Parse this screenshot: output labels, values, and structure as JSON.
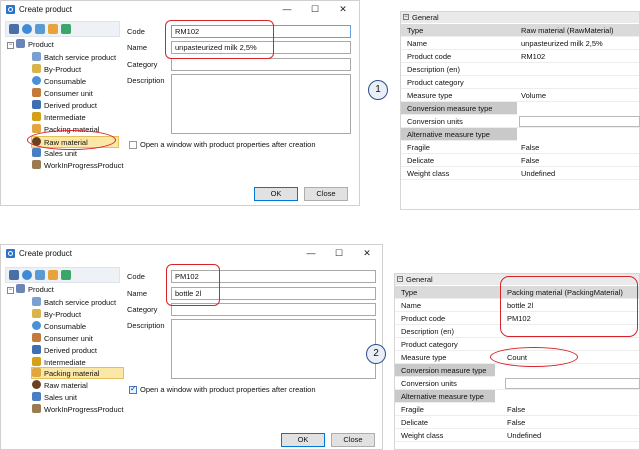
{
  "scene1": {
    "dialog": {
      "title": "Create product",
      "controls": [
        "—",
        "☐",
        "✕"
      ],
      "tree": [
        {
          "label": "Product"
        },
        {
          "label": "Batch service product"
        },
        {
          "label": "By-Product"
        },
        {
          "label": "Consumable"
        },
        {
          "label": "Consumer unit"
        },
        {
          "label": "Derived product"
        },
        {
          "label": "Intermediate"
        },
        {
          "label": "Packing material"
        },
        {
          "label": "Raw material"
        },
        {
          "label": "Sales unit"
        },
        {
          "label": "WorkInProgressProduct"
        }
      ],
      "selected_item": "Raw material",
      "code_label": "Code",
      "code_value": "RM102",
      "name_label": "Name",
      "name_value": "unpasteurized milk 2,5%",
      "category_label": "Category",
      "category_value": "",
      "description_label": "Description",
      "checkbox_label": "Open a window with product properties after creation",
      "checkbox_checked": false,
      "ok_label": "OK",
      "close_label": "Close"
    },
    "step_number": "1",
    "properties": {
      "section": "General",
      "rows": [
        {
          "name": "Type",
          "value": "Raw material (RawMaterial)"
        },
        {
          "name": "Name",
          "value": "unpasteurized milk 2,5%"
        },
        {
          "name": "Product code",
          "value": "RM102"
        },
        {
          "name": "Description (en)",
          "value": ""
        },
        {
          "name": "Product category",
          "value": ""
        },
        {
          "name": "Measure type",
          "value": "Volume"
        },
        {
          "name": "Conversion measure type",
          "value": ""
        },
        {
          "name": "Conversion units",
          "value": ""
        },
        {
          "name": "Alternative measure type",
          "value": ""
        },
        {
          "name": "Fragile",
          "value": "False"
        },
        {
          "name": "Delicate",
          "value": "False"
        },
        {
          "name": "Weight class",
          "value": "Undefined"
        }
      ]
    }
  },
  "scene2": {
    "dialog": {
      "title": "Create product",
      "controls": [
        "—",
        "☐",
        "✕"
      ],
      "tree": [
        {
          "label": "Product"
        },
        {
          "label": "Batch service product"
        },
        {
          "label": "By-Product"
        },
        {
          "label": "Consumable"
        },
        {
          "label": "Consumer unit"
        },
        {
          "label": "Derived product"
        },
        {
          "label": "Intermediate"
        },
        {
          "label": "Packing material"
        },
        {
          "label": "Raw material"
        },
        {
          "label": "Sales unit"
        },
        {
          "label": "WorkInProgressProduct"
        }
      ],
      "selected_item": "Packing material",
      "code_label": "Code",
      "code_value": "PM102",
      "name_label": "Name",
      "name_value": "bottle 2l",
      "category_label": "Category",
      "category_value": "",
      "description_label": "Description",
      "checkbox_label": "Open a window with product properties after creation",
      "checkbox_checked": true,
      "ok_label": "OK",
      "close_label": "Close"
    },
    "step_number": "2",
    "properties": {
      "section": "General",
      "rows": [
        {
          "name": "Type",
          "value": "Packing material (PackingMaterial)"
        },
        {
          "name": "Name",
          "value": "bottle 2l"
        },
        {
          "name": "Product code",
          "value": "PM102"
        },
        {
          "name": "Description (en)",
          "value": ""
        },
        {
          "name": "Product category",
          "value": ""
        },
        {
          "name": "Measure type",
          "value": "Count"
        },
        {
          "name": "Conversion measure type",
          "value": ""
        },
        {
          "name": "Conversion units",
          "value": ""
        },
        {
          "name": "Alternative measure type",
          "value": ""
        },
        {
          "name": "Fragile",
          "value": "False"
        },
        {
          "name": "Delicate",
          "value": "False"
        },
        {
          "name": "Weight class",
          "value": "Undefined"
        }
      ]
    }
  },
  "colors": {
    "annotation": "#d9232a",
    "selection": "#fbe7a6",
    "accent": "#0078d7"
  }
}
